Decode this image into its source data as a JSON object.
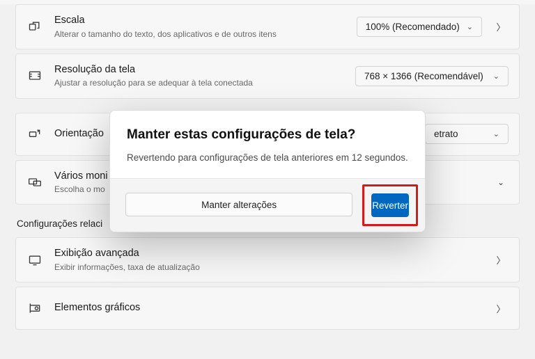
{
  "scale": {
    "title": "Escala",
    "sub": "Alterar o tamanho do texto, dos aplicativos e de outros itens",
    "value": "100% (Recomendado)"
  },
  "resolution": {
    "title": "Resolução da tela",
    "sub": "Ajustar a resolução para se adequar à tela conectada",
    "value": "768 × 1366 (Recomendável)"
  },
  "orientation": {
    "title": "Orientação",
    "value": "etrato"
  },
  "multi": {
    "title": "Vários moni",
    "sub": "Escolha o mo"
  },
  "section_label": "Configurações relaci",
  "advanced": {
    "title": "Exibição avançada",
    "sub": "Exibir informações, taxa de atualização"
  },
  "graphics": {
    "title": "Elementos gráficos"
  },
  "dialog": {
    "title": "Manter estas configurações de tela?",
    "text": "Revertendo para configurações de tela anteriores em 12 segundos.",
    "keep": "Manter alterações",
    "revert": "Reverter"
  }
}
